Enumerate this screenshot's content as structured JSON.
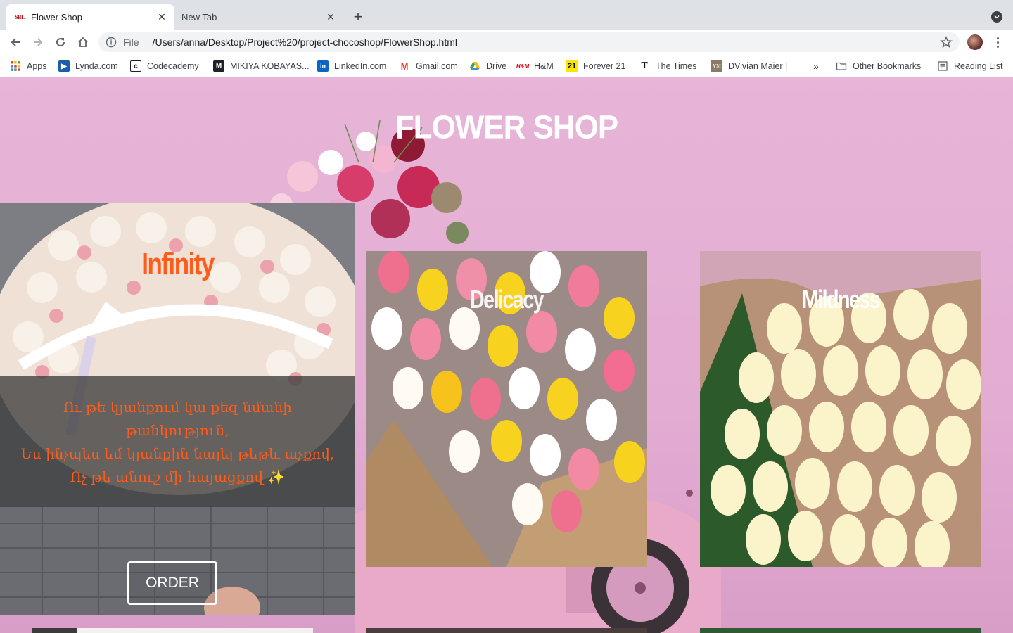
{
  "browser": {
    "tabs": [
      {
        "favicon_text": "SBL",
        "title": "Flower Shop",
        "active": true
      },
      {
        "title": "New Tab",
        "active": false
      }
    ],
    "address": {
      "scheme_label": "File",
      "url": "/Users/anna/Desktop/Project%20/project-chocoshop/FlowerShop.html"
    },
    "bookmarks": [
      {
        "label": "Apps",
        "icon": "apps-grid-icon"
      },
      {
        "label": "Lynda.com",
        "icon": "lynda-icon"
      },
      {
        "label": "Codecademy",
        "icon": "codecademy-icon"
      },
      {
        "label": "MIKIYA KOBAYAS...",
        "icon": "mikiya-icon"
      },
      {
        "label": "LinkedIn.com",
        "icon": "linkedin-icon"
      },
      {
        "label": "Gmail.com",
        "icon": "gmail-icon"
      },
      {
        "label": "Drive",
        "icon": "drive-icon"
      },
      {
        "label": "H&M",
        "icon": "hm-icon"
      },
      {
        "label": "Forever 21",
        "icon": "forever21-icon"
      },
      {
        "label": "The Times",
        "icon": "times-icon"
      },
      {
        "label": "DVivian Maier |",
        "icon": "vivian-maier-icon"
      }
    ],
    "overflow_label": "»",
    "other_bookmarks": "Other Bookmarks",
    "reading_list": "Reading List",
    "icon_glyphs": {
      "lynda": "▶",
      "codecademy": "c",
      "mikiya": "M",
      "linkedin": "in",
      "gmail": "M",
      "hm": "H&M",
      "forever21": "21",
      "times": "T",
      "vivian": "VM"
    }
  },
  "page": {
    "title": "FLOWER SHOP",
    "cards": [
      {
        "title": "Infinity",
        "poem_lines": [
          "Ու թե կյանքում կա քեզ նմանի",
          "թանկություն,",
          "Ես ինչպես եմ կյանքին նայել թեթև աչքով,",
          "Ոչ թե անուշ մի հայացքով ✨"
        ],
        "button": "ORDER"
      },
      {
        "title": "Delicacy"
      },
      {
        "title": "Mildness"
      }
    ]
  },
  "colors": {
    "page_background": "#e7b5d7",
    "accent_orange": "#ff5b1a",
    "title_white": "#ffffff"
  }
}
